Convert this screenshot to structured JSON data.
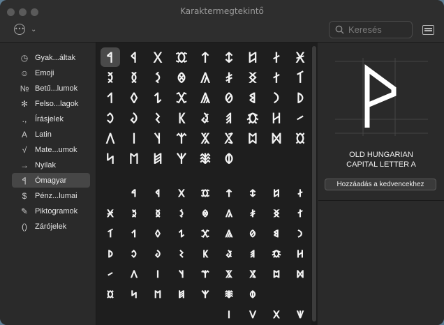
{
  "window": {
    "title": "Karaktermegtekintő"
  },
  "search": {
    "placeholder": "Keresés"
  },
  "sidebar": {
    "items": [
      {
        "label": "Gyak...áltak",
        "icon": "clock-icon",
        "glyph": "◷"
      },
      {
        "label": "Emoji",
        "icon": "smiley-icon",
        "glyph": "☺"
      },
      {
        "label": "Betű...lumok",
        "icon": "numero-icon",
        "glyph": "№"
      },
      {
        "label": "Felso...lagok",
        "icon": "asterisk-icon",
        "glyph": "✻"
      },
      {
        "label": "Írásjelek",
        "icon": "punctuation-icon",
        "glyph": ".,"
      },
      {
        "label": "Latin",
        "icon": "latin-a-icon",
        "glyph": "A"
      },
      {
        "label": "Mate...umok",
        "icon": "sqrt-icon",
        "glyph": "√"
      },
      {
        "label": "Nyilak",
        "icon": "arrow-icon",
        "glyph": "→"
      },
      {
        "label": "Ómagyar",
        "icon": "old-hungarian-icon",
        "glyph": "𐲀"
      },
      {
        "label": "Pénz...lumai",
        "icon": "dollar-icon",
        "glyph": "$"
      },
      {
        "label": "Piktogramok",
        "icon": "pictogram-icon",
        "glyph": "✎"
      },
      {
        "label": "Zárójelek",
        "icon": "parentheses-icon",
        "glyph": "()"
      }
    ],
    "active_index": 8
  },
  "grid": {
    "upper_rows": [
      [
        "𐲀",
        "𐲁",
        "𐲂",
        "𐲃",
        "𐲄",
        "𐲅",
        "𐲆",
        "𐲇",
        "𐲈"
      ],
      [
        "𐲉",
        "𐲊",
        "𐲋",
        "𐲌",
        "𐲍",
        "𐲎",
        "𐲏",
        "𐲐",
        "𐲑"
      ],
      [
        "𐲒",
        "𐲓",
        "𐲔",
        "𐲕",
        "𐲖",
        "𐲗",
        "𐲘",
        "𐲙",
        "𐲚"
      ],
      [
        "𐲛",
        "𐲜",
        "𐲝",
        "𐲞",
        "𐲟",
        "𐲠",
        "𐲡",
        "𐲢",
        "𐲣"
      ],
      [
        "𐲤",
        "𐲥",
        "𐲦",
        "𐲧",
        "𐲨",
        "𐲩",
        "𐲪",
        "𐲫",
        "𐲬"
      ],
      [
        "𐲭",
        "𐲮",
        "𐲯",
        "𐲰",
        "𐲱",
        "𐲲"
      ]
    ],
    "lower_rows": [
      [
        "𐳀",
        "𐳁",
        "𐳂",
        "𐳃",
        "𐳄",
        "𐳅",
        "𐳆",
        "𐳇"
      ],
      [
        "𐳈",
        "𐳉",
        "𐳊",
        "𐳋",
        "𐳌",
        "𐳍",
        "𐳎",
        "𐳏",
        "𐳐"
      ],
      [
        "𐳑",
        "𐳒",
        "𐳓",
        "𐳔",
        "𐳕",
        "𐳖",
        "𐳗",
        "𐳘",
        "𐳙"
      ],
      [
        "𐳚",
        "𐳛",
        "𐳜",
        "𐳝",
        "𐳞",
        "𐳟",
        "𐳠",
        "𐳡",
        "𐳢"
      ],
      [
        "𐳣",
        "𐳤",
        "𐳥",
        "𐳦",
        "𐳧",
        "𐳨",
        "𐳩",
        "𐳪",
        "𐳫"
      ],
      [
        "𐳬",
        "𐳭",
        "𐳮",
        "𐳯",
        "𐳰",
        "𐳱",
        "𐳲"
      ],
      [
        "𐳺",
        "𐳻",
        "𐳼",
        "𐳽"
      ]
    ],
    "selected": "𐲀"
  },
  "detail": {
    "name_line1": "OLD HUNGARIAN",
    "name_line2": "CAPITAL LETTER A",
    "favorite_button": "Hozzáadás a kedvencekhez"
  }
}
